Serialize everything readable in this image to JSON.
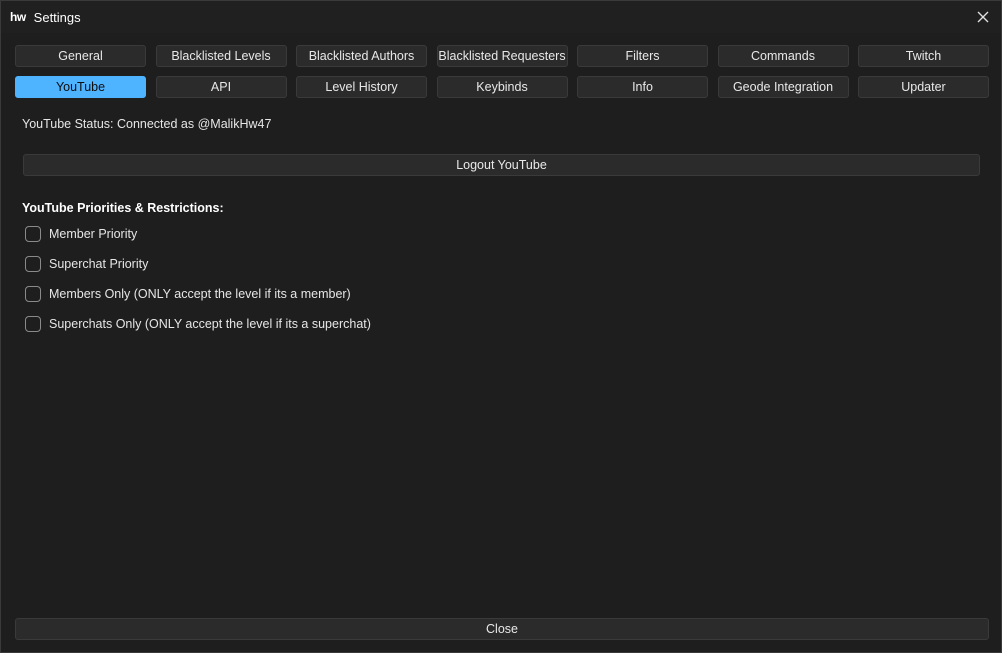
{
  "window": {
    "logo": "hw",
    "title": "Settings"
  },
  "tabs": [
    {
      "label": "General",
      "active": false
    },
    {
      "label": "Blacklisted Levels",
      "active": false
    },
    {
      "label": "Blacklisted Authors",
      "active": false
    },
    {
      "label": "Blacklisted Requesters",
      "active": false
    },
    {
      "label": "Filters",
      "active": false
    },
    {
      "label": "Commands",
      "active": false
    },
    {
      "label": "Twitch",
      "active": false
    },
    {
      "label": "YouTube",
      "active": true
    },
    {
      "label": "API",
      "active": false
    },
    {
      "label": "Level History",
      "active": false
    },
    {
      "label": "Keybinds",
      "active": false
    },
    {
      "label": "Info",
      "active": false
    },
    {
      "label": "Geode Integration",
      "active": false
    },
    {
      "label": "Updater",
      "active": false
    }
  ],
  "youtube": {
    "status": "YouTube Status: Connected as @MalikHw47",
    "logout_label": "Logout YouTube",
    "section_title": "YouTube Priorities & Restrictions:",
    "options": [
      {
        "label": "Member Priority",
        "checked": false
      },
      {
        "label": "Superchat Priority",
        "checked": false
      },
      {
        "label": "Members Only (ONLY accept the level if its a member)",
        "checked": false
      },
      {
        "label": "Superchats Only (ONLY accept the level if its a superchat)",
        "checked": false
      }
    ]
  },
  "footer": {
    "close_label": "Close"
  },
  "colors": {
    "accent": "#4fb4ff",
    "background": "#1e1e1e",
    "button": "#2b2b2b"
  }
}
